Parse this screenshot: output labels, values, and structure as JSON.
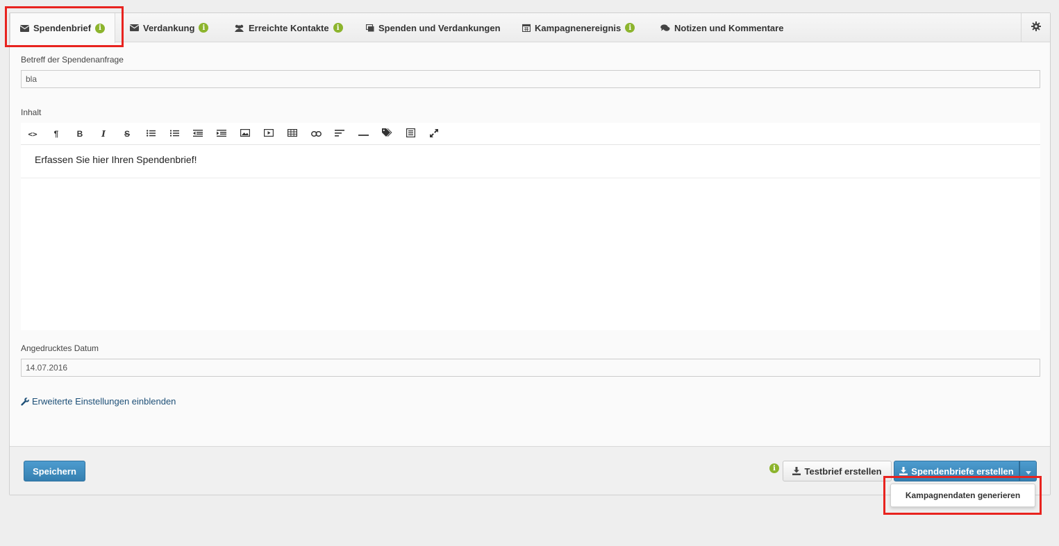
{
  "tabs": [
    {
      "label": "Spendenbrief",
      "icon": "envelope-icon",
      "info": true,
      "active": true
    },
    {
      "label": "Verdankung",
      "icon": "envelope-icon",
      "info": true
    },
    {
      "label": "Erreichte Kontakte",
      "icon": "users-icon",
      "info": true
    },
    {
      "label": "Spenden und Verdankungen",
      "icon": "money-icon",
      "info": false
    },
    {
      "label": "Kampagnenereignis",
      "icon": "calendar-icon",
      "info": true
    },
    {
      "label": "Notizen und Kommentare",
      "icon": "comments-icon",
      "info": false
    }
  ],
  "form": {
    "subject_label": "Betreff der Spendenanfrage",
    "subject_value": "bla",
    "content_label": "Inhalt",
    "content_text": "Erfassen Sie hier Ihren Spendenbrief!",
    "date_label": "Angedrucktes Datum",
    "date_value": "14.07.2016",
    "advanced_link": "Erweiterte Einstellungen einblenden"
  },
  "toolbar": {
    "code": "<>",
    "paragraph": "¶",
    "bold": "B",
    "italic": "I",
    "strike": "S"
  },
  "footer": {
    "save": "Speichern",
    "test_letter": "Testbrief erstellen",
    "create_letters": "Spendenbriefe erstellen",
    "dropdown_item": "Kampagnendaten generieren",
    "info_glyph": "i"
  },
  "colors": {
    "primary": "#4d9ccf",
    "info": "#8cb42d",
    "highlight": "#e8231f",
    "link": "#1d4f77"
  }
}
